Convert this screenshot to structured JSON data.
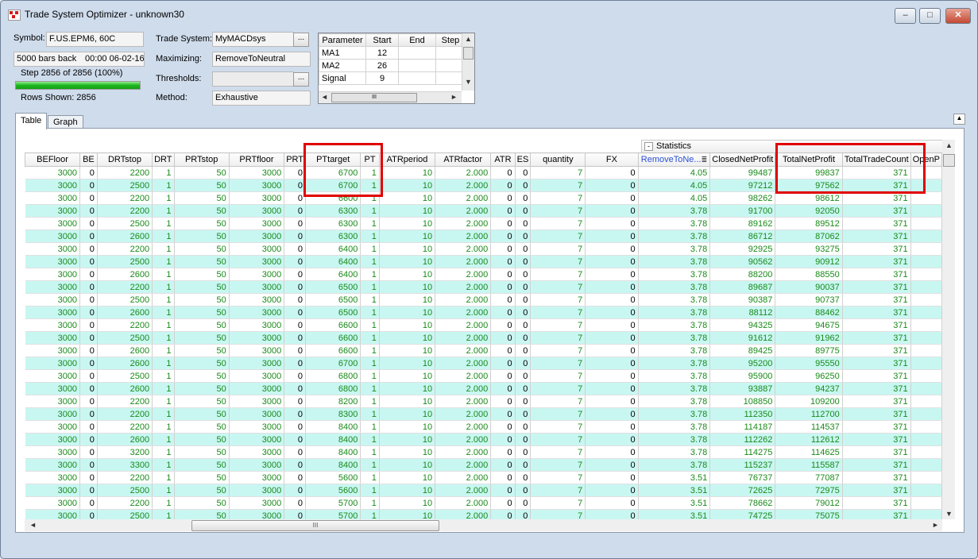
{
  "window": {
    "title": "Trade System Optimizer - unknown30",
    "min_label": "–",
    "max_label": "□",
    "close_label": "✕"
  },
  "info": {
    "symbol_label": "Symbol:",
    "symbol_value": "F.US.EPM6, 60C",
    "bars_back": "5000 bars back",
    "time": "00:00 06-02-16",
    "step_text": "Step 2856 of 2856  (100%)",
    "progress_fraction": 1.0,
    "rows_shown": "Rows Shown: 2856"
  },
  "settings": {
    "trade_system_label": "Trade System:",
    "trade_system_value": "MyMACDsys",
    "maximizing_label": "Maximizing:",
    "maximizing_value": "RemoveToNeutral",
    "thresholds_label": "Thresholds:",
    "thresholds_value": "",
    "method_label": "Method:",
    "method_value": "Exhaustive",
    "browse_label": "..."
  },
  "param_grid": {
    "headers": [
      "Parameter",
      "Start",
      "End",
      "Step"
    ],
    "rows": [
      [
        "MA1",
        "12",
        "",
        ""
      ],
      [
        "MA2",
        "26",
        "",
        ""
      ],
      [
        "Signal",
        "9",
        "",
        ""
      ]
    ],
    "scroll_thumb": "III"
  },
  "tabs": [
    "Table",
    "Graph"
  ],
  "collapse_label": "▲",
  "statistics_label": "Statistics",
  "statistics_toggle": "-",
  "sort_icon": "≣",
  "columns": [
    "BEFloor",
    "BE",
    "DRTstop",
    "DRT",
    "PRTstop",
    "PRTfloor",
    "PRT",
    "PTtarget",
    "PT",
    "ATRperiod",
    "ATRfactor",
    "ATR",
    "ES",
    "quantity",
    "FX",
    "RemoveToNe...",
    "ClosedNetProfit",
    "TotalNetProfit",
    "TotalTradeCount",
    "OpenP"
  ],
  "rows": [
    [
      "3000",
      "0",
      "2200",
      "1",
      "50",
      "3000",
      "0",
      "6700",
      "1",
      "10",
      "2.000",
      "0",
      "0",
      "7",
      "0",
      "4.05",
      "99487",
      "99837",
      "371"
    ],
    [
      "3000",
      "0",
      "2500",
      "1",
      "50",
      "3000",
      "0",
      "6700",
      "1",
      "10",
      "2.000",
      "0",
      "0",
      "7",
      "0",
      "4.05",
      "97212",
      "97562",
      "371"
    ],
    [
      "3000",
      "0",
      "2200",
      "1",
      "50",
      "3000",
      "0",
      "6600",
      "1",
      "10",
      "2.000",
      "0",
      "0",
      "7",
      "0",
      "4.05",
      "98262",
      "98612",
      "371"
    ],
    [
      "3000",
      "0",
      "2200",
      "1",
      "50",
      "3000",
      "0",
      "6300",
      "1",
      "10",
      "2.000",
      "0",
      "0",
      "7",
      "0",
      "3.78",
      "91700",
      "92050",
      "371"
    ],
    [
      "3000",
      "0",
      "2500",
      "1",
      "50",
      "3000",
      "0",
      "6300",
      "1",
      "10",
      "2.000",
      "0",
      "0",
      "7",
      "0",
      "3.78",
      "89162",
      "89512",
      "371"
    ],
    [
      "3000",
      "0",
      "2600",
      "1",
      "50",
      "3000",
      "0",
      "6300",
      "1",
      "10",
      "2.000",
      "0",
      "0",
      "7",
      "0",
      "3.78",
      "86712",
      "87062",
      "371"
    ],
    [
      "3000",
      "0",
      "2200",
      "1",
      "50",
      "3000",
      "0",
      "6400",
      "1",
      "10",
      "2.000",
      "0",
      "0",
      "7",
      "0",
      "3.78",
      "92925",
      "93275",
      "371"
    ],
    [
      "3000",
      "0",
      "2500",
      "1",
      "50",
      "3000",
      "0",
      "6400",
      "1",
      "10",
      "2.000",
      "0",
      "0",
      "7",
      "0",
      "3.78",
      "90562",
      "90912",
      "371"
    ],
    [
      "3000",
      "0",
      "2600",
      "1",
      "50",
      "3000",
      "0",
      "6400",
      "1",
      "10",
      "2.000",
      "0",
      "0",
      "7",
      "0",
      "3.78",
      "88200",
      "88550",
      "371"
    ],
    [
      "3000",
      "0",
      "2200",
      "1",
      "50",
      "3000",
      "0",
      "6500",
      "1",
      "10",
      "2.000",
      "0",
      "0",
      "7",
      "0",
      "3.78",
      "89687",
      "90037",
      "371"
    ],
    [
      "3000",
      "0",
      "2500",
      "1",
      "50",
      "3000",
      "0",
      "6500",
      "1",
      "10",
      "2.000",
      "0",
      "0",
      "7",
      "0",
      "3.78",
      "90387",
      "90737",
      "371"
    ],
    [
      "3000",
      "0",
      "2600",
      "1",
      "50",
      "3000",
      "0",
      "6500",
      "1",
      "10",
      "2.000",
      "0",
      "0",
      "7",
      "0",
      "3.78",
      "88112",
      "88462",
      "371"
    ],
    [
      "3000",
      "0",
      "2200",
      "1",
      "50",
      "3000",
      "0",
      "6600",
      "1",
      "10",
      "2.000",
      "0",
      "0",
      "7",
      "0",
      "3.78",
      "94325",
      "94675",
      "371"
    ],
    [
      "3000",
      "0",
      "2500",
      "1",
      "50",
      "3000",
      "0",
      "6600",
      "1",
      "10",
      "2.000",
      "0",
      "0",
      "7",
      "0",
      "3.78",
      "91612",
      "91962",
      "371"
    ],
    [
      "3000",
      "0",
      "2600",
      "1",
      "50",
      "3000",
      "0",
      "6600",
      "1",
      "10",
      "2.000",
      "0",
      "0",
      "7",
      "0",
      "3.78",
      "89425",
      "89775",
      "371"
    ],
    [
      "3000",
      "0",
      "2600",
      "1",
      "50",
      "3000",
      "0",
      "6700",
      "1",
      "10",
      "2.000",
      "0",
      "0",
      "7",
      "0",
      "3.78",
      "95200",
      "95550",
      "371"
    ],
    [
      "3000",
      "0",
      "2500",
      "1",
      "50",
      "3000",
      "0",
      "6800",
      "1",
      "10",
      "2.000",
      "0",
      "0",
      "7",
      "0",
      "3.78",
      "95900",
      "96250",
      "371"
    ],
    [
      "3000",
      "0",
      "2600",
      "1",
      "50",
      "3000",
      "0",
      "6800",
      "1",
      "10",
      "2.000",
      "0",
      "0",
      "7",
      "0",
      "3.78",
      "93887",
      "94237",
      "371"
    ],
    [
      "3000",
      "0",
      "2200",
      "1",
      "50",
      "3000",
      "0",
      "8200",
      "1",
      "10",
      "2.000",
      "0",
      "0",
      "7",
      "0",
      "3.78",
      "108850",
      "109200",
      "371"
    ],
    [
      "3000",
      "0",
      "2200",
      "1",
      "50",
      "3000",
      "0",
      "8300",
      "1",
      "10",
      "2.000",
      "0",
      "0",
      "7",
      "0",
      "3.78",
      "112350",
      "112700",
      "371"
    ],
    [
      "3000",
      "0",
      "2200",
      "1",
      "50",
      "3000",
      "0",
      "8400",
      "1",
      "10",
      "2.000",
      "0",
      "0",
      "7",
      "0",
      "3.78",
      "114187",
      "114537",
      "371"
    ],
    [
      "3000",
      "0",
      "2600",
      "1",
      "50",
      "3000",
      "0",
      "8400",
      "1",
      "10",
      "2.000",
      "0",
      "0",
      "7",
      "0",
      "3.78",
      "112262",
      "112612",
      "371"
    ],
    [
      "3000",
      "0",
      "3200",
      "1",
      "50",
      "3000",
      "0",
      "8400",
      "1",
      "10",
      "2.000",
      "0",
      "0",
      "7",
      "0",
      "3.78",
      "114275",
      "114625",
      "371"
    ],
    [
      "3000",
      "0",
      "3300",
      "1",
      "50",
      "3000",
      "0",
      "8400",
      "1",
      "10",
      "2.000",
      "0",
      "0",
      "7",
      "0",
      "3.78",
      "115237",
      "115587",
      "371"
    ],
    [
      "3000",
      "0",
      "2200",
      "1",
      "50",
      "3000",
      "0",
      "5600",
      "1",
      "10",
      "2.000",
      "0",
      "0",
      "7",
      "0",
      "3.51",
      "76737",
      "77087",
      "371"
    ],
    [
      "3000",
      "0",
      "2500",
      "1",
      "50",
      "3000",
      "0",
      "5600",
      "1",
      "10",
      "2.000",
      "0",
      "0",
      "7",
      "0",
      "3.51",
      "72625",
      "72975",
      "371"
    ],
    [
      "3000",
      "0",
      "2200",
      "1",
      "50",
      "3000",
      "0",
      "5700",
      "1",
      "10",
      "2.000",
      "0",
      "0",
      "7",
      "0",
      "3.51",
      "78662",
      "79012",
      "371"
    ],
    [
      "3000",
      "0",
      "2500",
      "1",
      "50",
      "3000",
      "0",
      "5700",
      "1",
      "10",
      "2.000",
      "0",
      "0",
      "7",
      "0",
      "3.51",
      "74725",
      "75075",
      "371"
    ]
  ],
  "hscroll_thumb": "III",
  "accent_highlight": "#e00000",
  "grid_alt_row": "#c8f7f2",
  "value_green": "#1a8a1a"
}
